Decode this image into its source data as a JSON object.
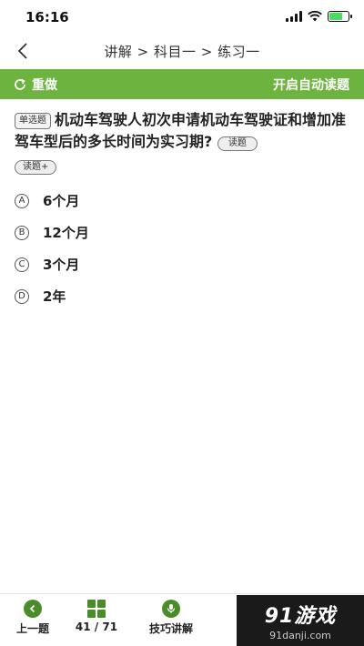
{
  "status": {
    "time": "16:16"
  },
  "nav": {
    "title": "讲解 > 科目一 > 练习一"
  },
  "toolbar": {
    "redo_label": "重做",
    "auto_read_label": "开启自动读题"
  },
  "question": {
    "type": "单选题",
    "text": "机动车驾驶人初次申请机动车驾驶证和增加准驾车型后的多长时间为实习期?",
    "read_label": "读题",
    "read_plus_label": "读题+"
  },
  "options": [
    {
      "letter": "A",
      "text": "6个月"
    },
    {
      "letter": "B",
      "text": "12个月"
    },
    {
      "letter": "C",
      "text": "3个月"
    },
    {
      "letter": "D",
      "text": "2年"
    }
  ],
  "bottom": {
    "prev_label": "上一题",
    "progress": "41 / 71",
    "tips_label": "技巧讲解"
  },
  "watermark": {
    "logo": "91游戏",
    "sub": "91danji.com"
  },
  "colors": {
    "accent": "#6db33f",
    "icon_green": "#4b8c2a"
  }
}
